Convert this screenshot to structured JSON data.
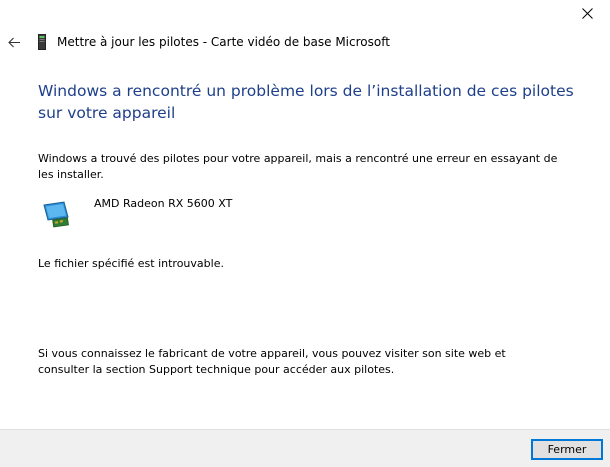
{
  "window": {
    "title": "Mettre à jour les pilotes - Carte vidéo de base Microsoft"
  },
  "icons": {
    "close": "close-icon",
    "back": "back-arrow-icon",
    "dialog": "device-driver-icon",
    "device": "display-adapter-icon"
  },
  "colors": {
    "heading": "#1e3f8a",
    "footer_bg": "#f0f0f0",
    "button_border": "#0078d7"
  },
  "main": {
    "heading": "Windows a rencontré un problème lors de l’installation de ces pilotes sur votre appareil",
    "intro": "Windows a trouvé des pilotes pour votre appareil, mais a rencontré une erreur en essayant de les installer.",
    "device_name": "AMD Radeon RX 5600 XT",
    "error": "Le fichier spécifié est introuvable.",
    "support": "Si vous connaissez le fabricant de votre appareil, vous pouvez visiter son site web et consulter la section Support technique pour accéder aux pilotes."
  },
  "footer": {
    "close_label": "Fermer"
  }
}
